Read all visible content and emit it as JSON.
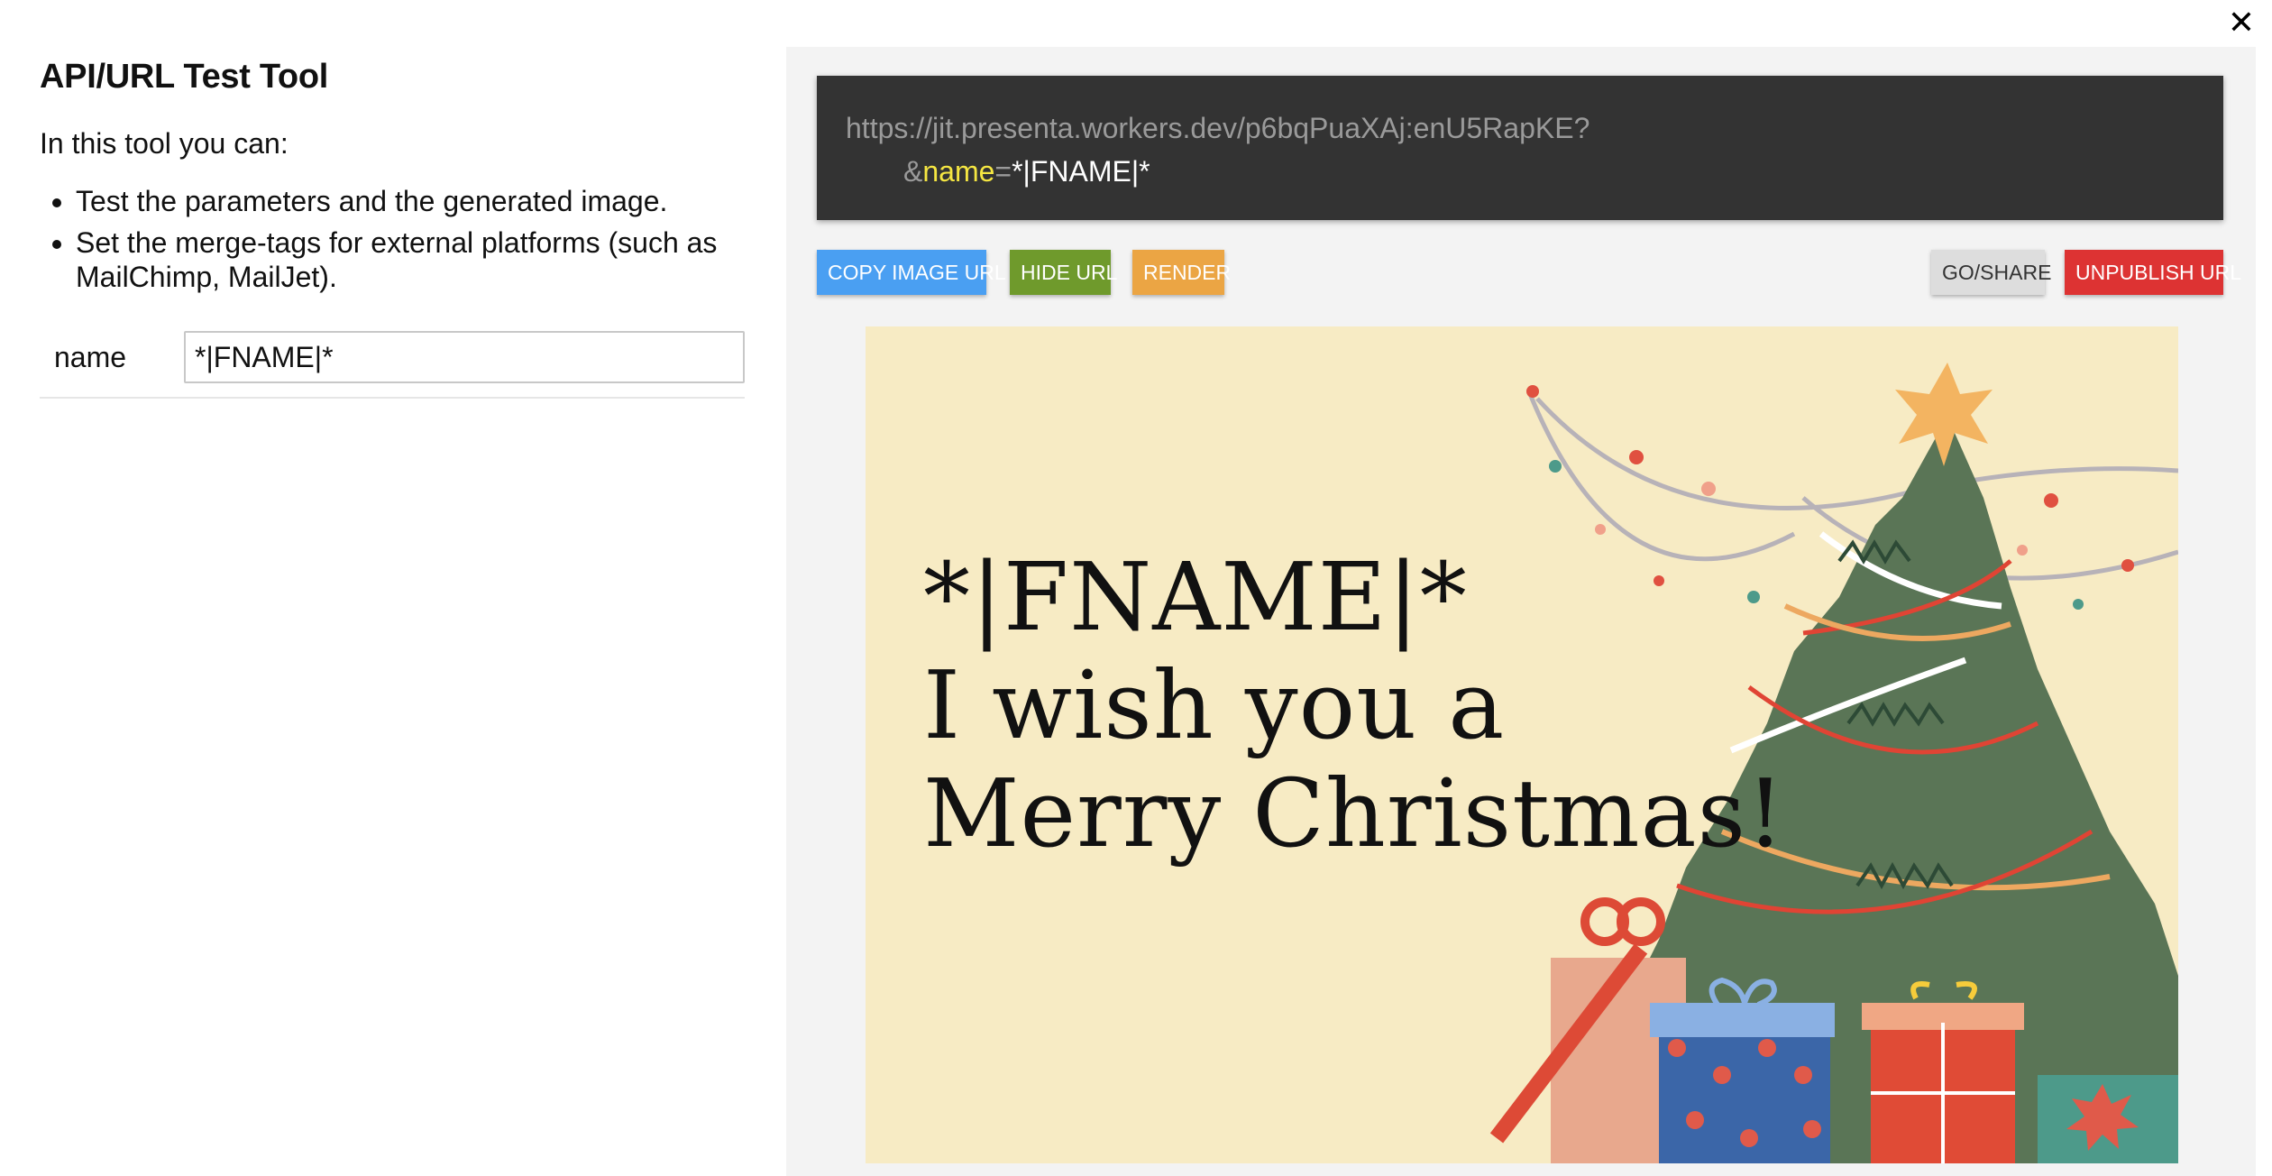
{
  "dialog": {
    "close_glyph": "✕"
  },
  "left": {
    "title": "API/URL Test Tool",
    "intro": "In this tool you can:",
    "features": [
      "Test the parameters and the generated image.",
      "Set the merge-tags for external platforms (such as MailChimp, MailJet)."
    ],
    "params": [
      {
        "label": "name",
        "value": "*|FNAME|*"
      }
    ]
  },
  "right": {
    "url": {
      "base": "https://jit.presenta.workers.dev/p6bqPuaXAj:enU5RapKE?",
      "amp": "&",
      "key": "name",
      "eq": "=",
      "value": "*|FNAME|*"
    },
    "buttons": {
      "copy": "COPY IMAGE URL",
      "hide": "HIDE URL",
      "render": "RENDER",
      "share": "GO/SHARE",
      "unpublish": "UNPUBLISH URL"
    },
    "card": {
      "line1": "*|FNAME|*",
      "line2": "I wish you a",
      "line3": "Merry Christmas!"
    }
  },
  "colors": {
    "copy_button": "#4a9ff2",
    "hide_button": "#6f9a2c",
    "render_button": "#eba544",
    "share_button": "#dddddd",
    "unpublish_button": "#dd3333",
    "url_key": "#f5e642",
    "card_background": "#f7ebc4",
    "tree": "#5a7556"
  }
}
